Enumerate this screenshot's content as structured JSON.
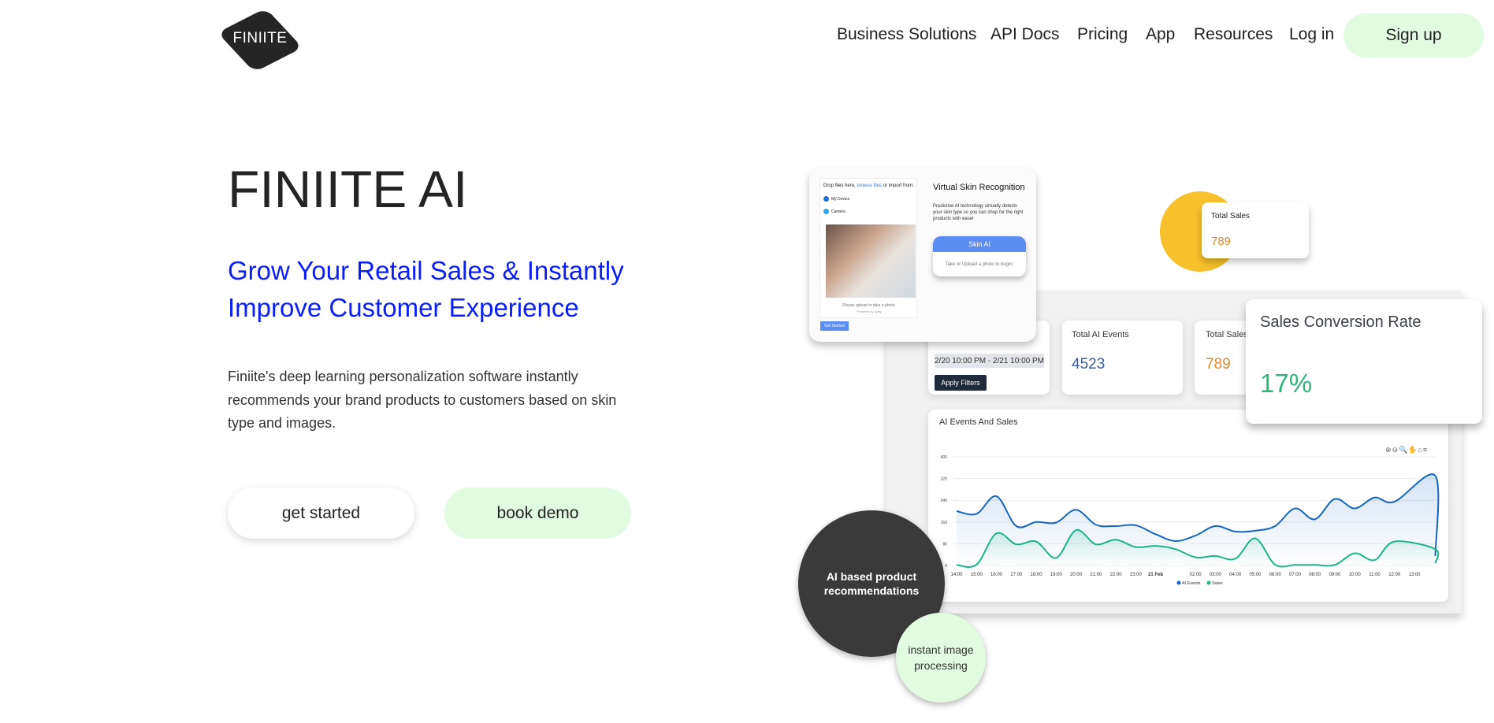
{
  "header": {
    "logo": "FINIITE",
    "nav": [
      "Business Solutions",
      "API Docs",
      "Pricing",
      "App",
      "Resources",
      "Log in"
    ],
    "signup": "Sign up"
  },
  "hero": {
    "title": "FINIITE AI",
    "subtitle_1": "Grow Your Retail Sales & Instantly",
    "subtitle_2": "Improve Customer Experience",
    "paragraph": "Finiite's deep learning personalization software instantly recommends your brand products to customers based on skin type and images.",
    "get_started": "get started",
    "book_demo": "book demo"
  },
  "colors": {
    "accent_blue": "#0a1ff5",
    "mint": "#e0fbdf",
    "dark": "#3a3a3a",
    "yellow": "#f8c12b",
    "events_line": "#1565c0",
    "sales_line": "#1cb38a"
  },
  "skin_card": {
    "drop": "Drop files here, ",
    "browse": "browse files",
    "import": " or import from:",
    "my_device": "My Device",
    "camera": "Camera",
    "please": "Please upload or take a photo.",
    "powered": "Powered by Uppy",
    "get_started": "Get Started",
    "title": "Virtual Skin Recognition",
    "desc": "Predictive AI technology virtually detects your skin type so you can shop for the right products with ease!",
    "skin_ai": "Skin AI",
    "take": "Take or Upload a photo to begin."
  },
  "total_sales_float": {
    "label": "Total Sales",
    "value": "789"
  },
  "dashboard": {
    "date_range": "2/20 10:00 PM - 2/21 10:00 PM",
    "apply": "Apply Filters",
    "ai_events_label": "Total AI Events",
    "ai_events_value": "4523",
    "sales_label": "Total Sales",
    "sales_value": "789",
    "conversion_label": "Sales Conversion Rate",
    "conversion_value": "17%",
    "chart_title": "AI Events And Sales"
  },
  "bubbles": {
    "dark": "AI based product recommendations",
    "green": "instant image processing"
  },
  "chart_data": {
    "type": "area",
    "title": "AI Events And Sales",
    "ylim": [
      0,
      400
    ],
    "y_ticks": [
      "0",
      "80",
      "160",
      "240",
      "320",
      "400"
    ],
    "x_tick_labels": [
      "14:00",
      "15:00",
      "16:00",
      "17:00",
      "18:00",
      "19:00",
      "20:00",
      "21:00",
      "22:00",
      "23:00",
      "21 Feb",
      "",
      "02:00",
      "03:00",
      "04:00",
      "05:00",
      "06:00",
      "07:00",
      "08:00",
      "09:00",
      "10:00",
      "11:00",
      "12:00",
      "13:00"
    ],
    "series": [
      {
        "name": "AI Events",
        "values": [
          200,
          190,
          255,
          145,
          160,
          158,
          205,
          150,
          145,
          148,
          115,
          90,
          110,
          145,
          125,
          128,
          145,
          210,
          170,
          245,
          210,
          250,
          235,
          330,
          35
        ]
      },
      {
        "name": "Sales",
        "values": [
          2,
          3,
          118,
          78,
          88,
          28,
          130,
          78,
          95,
          68,
          72,
          60,
          30,
          35,
          25,
          100,
          3,
          2,
          2,
          2,
          45,
          20,
          88,
          60,
          8
        ]
      }
    ],
    "legend": "bottom",
    "grid": true
  }
}
